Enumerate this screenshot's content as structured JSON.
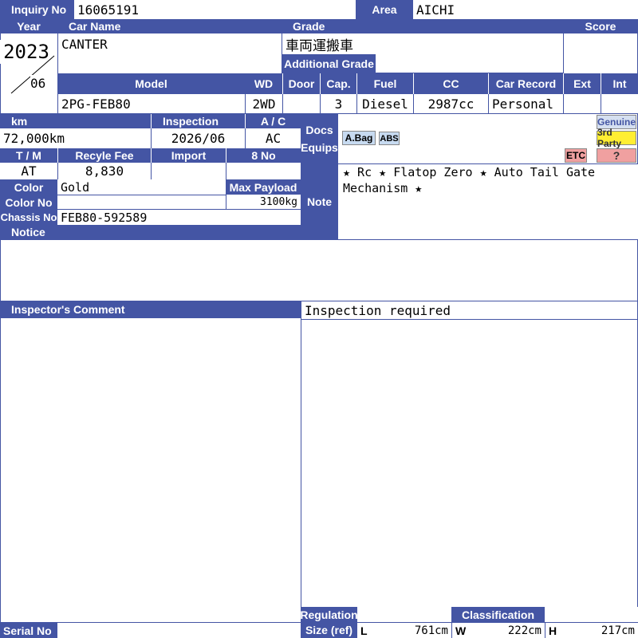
{
  "header": {
    "inquiry_label": "Inquiry No",
    "inquiry_value": "16065191",
    "area_label": "Area",
    "area_value": "AICHI"
  },
  "row_year": {
    "year_label": "Year",
    "car_name_label": "Car Name",
    "grade_label": "Grade",
    "score_label": "Score",
    "year_value": "2023",
    "month_value": "06",
    "car_name_value": "CANTER",
    "grade_value": "車両運搬車",
    "additional_grade_label": "Additional Grade",
    "additional_grade_value": ""
  },
  "row_model": {
    "model_label": "Model",
    "wd_label": "WD",
    "door_label": "Door",
    "cap_label": "Cap.",
    "fuel_label": "Fuel",
    "cc_label": "CC",
    "car_record_label": "Car Record",
    "ext_label": "Ext",
    "int_label": "Int",
    "model_value": "2PG-FEB80",
    "wd_value": "2WD",
    "door_value": "",
    "cap_value": "3",
    "fuel_value": "Diesel",
    "cc_value": "2987cc",
    "car_record_value": "Personal",
    "ext_value": "",
    "int_value": ""
  },
  "row_km": {
    "km_label": "km",
    "inspection_label": "Inspection",
    "ac_label": "A / C",
    "km_value": "72,000km",
    "inspection_value": "2026/06",
    "ac_value": "AC"
  },
  "docs": {
    "docs_label": "Docs",
    "equips_label": "Equips",
    "tags": {
      "abag": "A.Bag",
      "abs": "ABS",
      "etc": "ETC"
    },
    "genuine_label": "Genuine",
    "third_party_label": "3rd Party",
    "unknown_label": "?"
  },
  "row_tm": {
    "tm_label": "T / M",
    "recycle_label": "Recyle Fee",
    "import_label": "Import",
    "no8_label": "8 No",
    "tm_value": "AT",
    "recycle_value": "8,830",
    "import_value": "",
    "no8_value": ""
  },
  "row_color": {
    "color_label": "Color",
    "color_value": "Gold",
    "max_payload_label": "Max Payload",
    "max_payload_value": "3100kg",
    "color_no_label": "Color No",
    "color_no_value": "",
    "chassis_label": "Chassis No",
    "chassis_value": "FEB80-592589",
    "notice_label": "Notice"
  },
  "note": {
    "note_label": "Note",
    "note_text": "★ Rc ★ Flatop Zero ★ Auto Tail Gate  Mechanism ★"
  },
  "inspector": {
    "comment_label": "Inspector's Comment",
    "comment_text": "Inspection required"
  },
  "footer": {
    "serial_label": "Serial No",
    "serial_value": "",
    "regulation_label": "Regulation",
    "classification_label": "Classification",
    "size_label": "Size (ref)",
    "l_label": "L",
    "l_value": "761cm",
    "w_label": "W",
    "w_value": "222cm",
    "h_label": "H",
    "h_value": "217cm"
  },
  "colors": {
    "header_blue": "#4455a4",
    "tag_blue": "#c7daf0",
    "tag_red": "#f0a0a0",
    "tag_yellow": "#ffee33",
    "genuine_bg": "#d5dff0"
  }
}
